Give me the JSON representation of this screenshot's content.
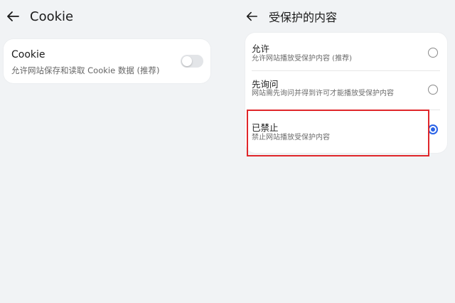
{
  "left_panel": {
    "title": "Cookie",
    "cookie_card": {
      "label": "Cookie",
      "description": "允许网站保存和读取 Cookie 数据 (推荐)",
      "toggle_on": false
    }
  },
  "right_panel": {
    "title": "受保护的内容",
    "options": [
      {
        "label": "允许",
        "description": "允许网站播放受保护内容 (推荐)",
        "selected": false
      },
      {
        "label": "先询问",
        "description": "网站需先询问并得到许可才能播放受保护内容",
        "selected": false
      },
      {
        "label": "已禁止",
        "description": "禁止网站播放受保护内容",
        "selected": true
      }
    ]
  },
  "colors": {
    "accent": "#2a62e6",
    "highlight_box": "#e0262a",
    "background": "#f1f3f5"
  },
  "icons": {
    "back": "arrow-left-icon"
  }
}
